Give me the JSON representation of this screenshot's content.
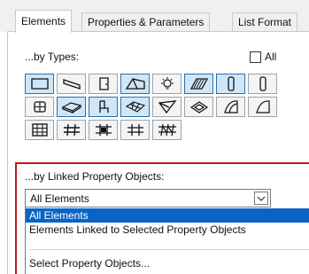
{
  "tabs": [
    {
      "label": "Elements",
      "active": true
    },
    {
      "label": "Properties & Parameters",
      "active": false
    },
    {
      "label": "List Format",
      "active": false
    }
  ],
  "by_types": {
    "label": "...by Types:",
    "all_checkbox_label": "All",
    "all_checked": false,
    "buttons": [
      {
        "icon": "wall-icon",
        "selected": true
      },
      {
        "icon": "beam-icon",
        "selected": false
      },
      {
        "icon": "door-icon",
        "selected": false
      },
      {
        "icon": "roof-icon",
        "selected": true
      },
      {
        "icon": "lamp-icon",
        "selected": false
      },
      {
        "icon": "slab-hatch-icon",
        "selected": true
      },
      {
        "icon": "column-icon",
        "selected": true
      },
      {
        "icon": "window-icon",
        "selected": false
      },
      {
        "icon": "slab-icon",
        "selected": true
      },
      {
        "icon": "object-chair-icon",
        "selected": true
      },
      {
        "icon": "mesh-icon",
        "selected": true
      },
      {
        "icon": "morph-icon",
        "selected": false
      },
      {
        "icon": "zone-icon",
        "selected": false
      },
      {
        "icon": "shell-icon",
        "selected": false
      },
      {
        "icon": "curtain-wall-icon",
        "selected": false
      },
      {
        "icon": "stair-icon",
        "selected": false
      },
      {
        "icon": "railing-icon",
        "selected": false
      },
      {
        "icon": "frame-icon",
        "selected": false
      },
      {
        "icon": "truss-icon",
        "selected": false
      }
    ]
  },
  "linked": {
    "label": "...by Linked Property Objects:",
    "select_value": "All Elements",
    "options": [
      {
        "label": "All Elements",
        "highlighted": true
      },
      {
        "label": "Elements Linked to Selected Property Objects",
        "highlighted": false
      }
    ],
    "footer_option": "Select Property Objects..."
  },
  "colors": {
    "highlight": "#0a64c8",
    "selected_button": "#cfe6f7",
    "annotation_border": "#c0161c"
  }
}
